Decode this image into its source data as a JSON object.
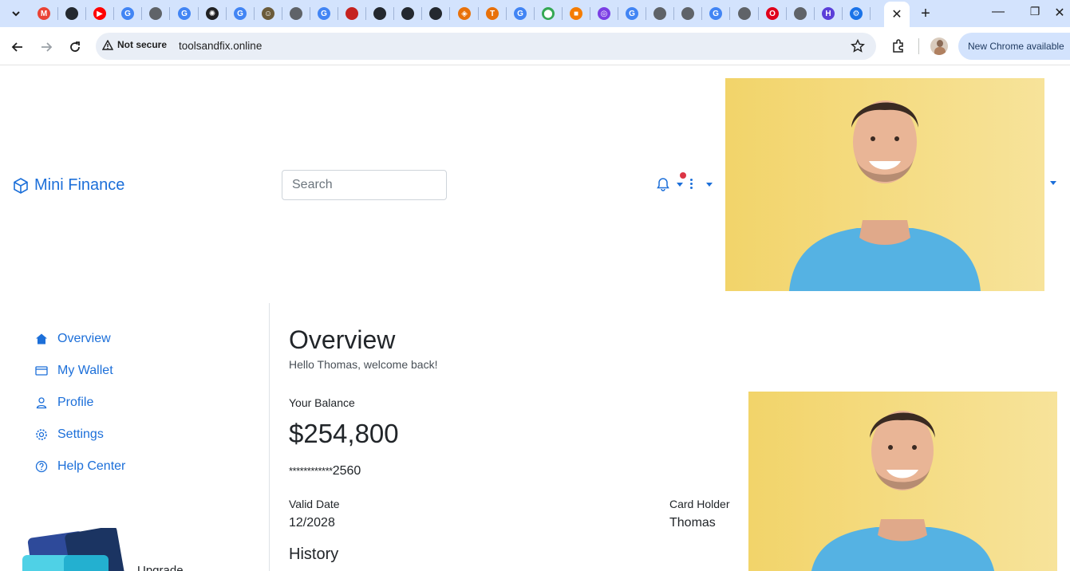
{
  "browser": {
    "address": {
      "security_label": "Not secure",
      "url": "toolsandfix.online"
    },
    "update_button": "New Chrome available",
    "tabs": [
      {
        "icon": "gmail-icon",
        "glyph": "M",
        "color": "#ea4335"
      },
      {
        "icon": "github-icon",
        "glyph": "",
        "color": "#24292f"
      },
      {
        "icon": "youtube-icon",
        "glyph": "▶",
        "color": "#ff0000"
      },
      {
        "icon": "google-icon",
        "glyph": "G",
        "color": "#4285f4"
      },
      {
        "icon": "globe-icon",
        "glyph": "",
        "color": "#5f6368"
      },
      {
        "icon": "google-icon",
        "glyph": "G",
        "color": "#4285f4"
      },
      {
        "icon": "openai-icon",
        "glyph": "✺",
        "color": "#202123"
      },
      {
        "icon": "google-icon",
        "glyph": "G",
        "color": "#4285f4"
      },
      {
        "icon": "avatar-icon",
        "glyph": "☺",
        "color": "#6b5b3a"
      },
      {
        "icon": "globe-icon",
        "glyph": "",
        "color": "#5f6368"
      },
      {
        "icon": "google-icon",
        "glyph": "G",
        "color": "#4285f4"
      },
      {
        "icon": "record-icon",
        "glyph": "",
        "color": "#c5221f"
      },
      {
        "icon": "github-icon",
        "glyph": "",
        "color": "#24292f"
      },
      {
        "icon": "github-icon",
        "glyph": "",
        "color": "#24292f"
      },
      {
        "icon": "github-icon",
        "glyph": "",
        "color": "#24292f"
      },
      {
        "icon": "stack-icon",
        "glyph": "◈",
        "color": "#e8710a"
      },
      {
        "icon": "text-t-icon",
        "glyph": "T",
        "color": "#e8710a"
      },
      {
        "icon": "google-icon",
        "glyph": "G",
        "color": "#4285f4"
      },
      {
        "icon": "maps-pin-icon",
        "glyph": "⬤",
        "color": "#34a853"
      },
      {
        "icon": "cube-icon",
        "glyph": "■",
        "color": "#f57c00"
      },
      {
        "icon": "app-icon",
        "glyph": "◎",
        "color": "#7b3fe4"
      },
      {
        "icon": "google-icon",
        "glyph": "G",
        "color": "#4285f4"
      },
      {
        "icon": "globe-icon",
        "glyph": "",
        "color": "#5f6368"
      },
      {
        "icon": "globe-icon",
        "glyph": "",
        "color": "#5f6368"
      },
      {
        "icon": "google-icon",
        "glyph": "G",
        "color": "#4285f4"
      },
      {
        "icon": "globe-icon",
        "glyph": "",
        "color": "#5f6368"
      },
      {
        "icon": "opera-icon",
        "glyph": "O",
        "color": "#e0001b"
      },
      {
        "icon": "globe-icon",
        "glyph": "",
        "color": "#5f6368"
      },
      {
        "icon": "hub-icon",
        "glyph": "H",
        "color": "#5b3fd9"
      },
      {
        "icon": "settings-gear-icon",
        "glyph": "⚙",
        "color": "#1a73e8"
      }
    ]
  },
  "app": {
    "brand": "Mini Finance",
    "search_placeholder": "Search",
    "accent": "#1c6fd9",
    "sidebar": {
      "items": [
        {
          "label": "Overview",
          "icon": "home-icon"
        },
        {
          "label": "My Wallet",
          "icon": "wallet-icon"
        },
        {
          "label": "Profile",
          "icon": "user-icon"
        },
        {
          "label": "Settings",
          "icon": "gear-icon"
        },
        {
          "label": "Help Center",
          "icon": "help-circle-icon"
        }
      ],
      "promo_label": "Upgrade"
    },
    "main": {
      "title": "Overview",
      "greeting": "Hello Thomas, welcome back!",
      "balance_label": "Your Balance",
      "balance": "$254,800",
      "card_number_mask": "************",
      "card_number_last": "2560",
      "valid_label": "Valid Date",
      "valid_value": "12/2028",
      "holder_label": "Card Holder",
      "holder_value": "Thomas",
      "history_title": "History"
    }
  }
}
